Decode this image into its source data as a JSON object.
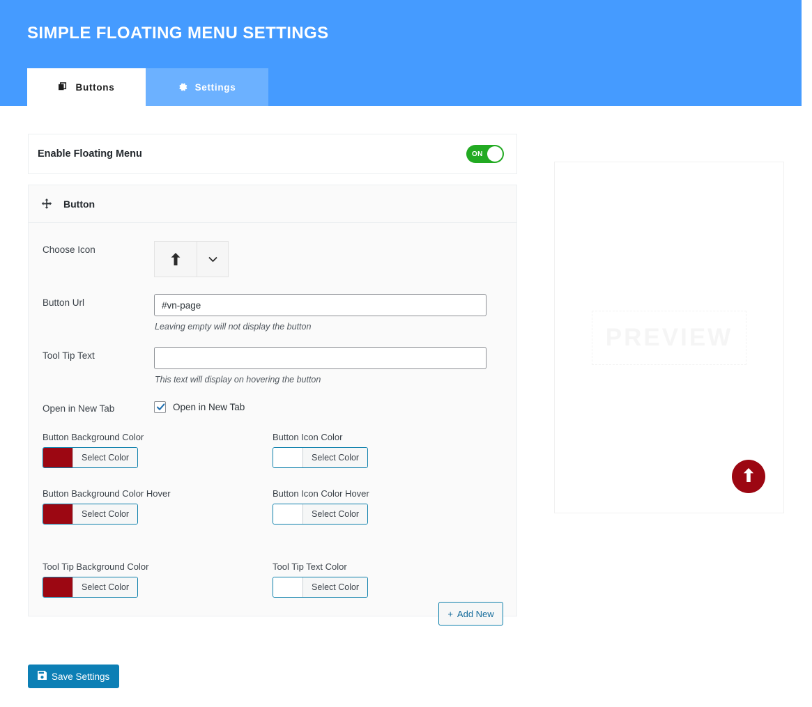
{
  "header": {
    "title": "Simple Floating Menu Settings",
    "tabs": [
      {
        "label": "Buttons",
        "icon": "layers-icon",
        "active": true
      },
      {
        "label": "Settings",
        "icon": "gear-icon",
        "active": false
      }
    ]
  },
  "enable_menu": {
    "label": "Enable Floating Menu",
    "toggle_state": "ON",
    "toggle_on_color": "#22aa22"
  },
  "button_panel": {
    "title": "Button",
    "drag_handle_icon": "move-icon",
    "choose_icon": {
      "label": "Choose Icon",
      "selected_icon": "arrow-up-icon",
      "caret_icon": "chevron-down-icon"
    },
    "button_url": {
      "label": "Button Url",
      "value": "#vn-page",
      "placeholder": "",
      "hint": "Leaving empty will not display the button"
    },
    "tooltip_text": {
      "label": "Tool Tip Text",
      "value": "",
      "placeholder": "",
      "hint": "This text will display on hovering the button"
    },
    "open_new_tab": {
      "label": "Open in New Tab",
      "checkbox_label": "Open in New Tab",
      "checked": true
    },
    "colors": [
      {
        "label": "Button Background Color",
        "swatch": "#9c0712",
        "button_label": "Select Color"
      },
      {
        "label": "Button Icon Color",
        "swatch": "#ffffff",
        "button_label": "Select Color"
      },
      {
        "label": "Button Background Color Hover",
        "swatch": "#9c0712",
        "button_label": "Select Color"
      },
      {
        "label": "Button Icon Color Hover",
        "swatch": "#ffffff",
        "button_label": "Select Color"
      },
      {
        "label": "Tool Tip Background Color",
        "swatch": "#9c0712",
        "button_label": "Select Color"
      },
      {
        "label": "Tool Tip Text Color",
        "swatch": "#ffffff",
        "button_label": "Select Color"
      }
    ]
  },
  "actions": {
    "add_new_label": "Add New",
    "add_new_icon": "plus-icon",
    "save_label": "Save Settings",
    "save_icon": "save-icon"
  },
  "preview": {
    "stamp_text": "PREVIEW",
    "fab_color": "#9c0712",
    "fab_icon": "arrow-up-icon"
  },
  "theme": {
    "header_blue": "#459bff",
    "tab_inactive_blue": "#6cb1ff",
    "save_blue": "#0c7fb5",
    "link_blue": "#0c7fab"
  }
}
